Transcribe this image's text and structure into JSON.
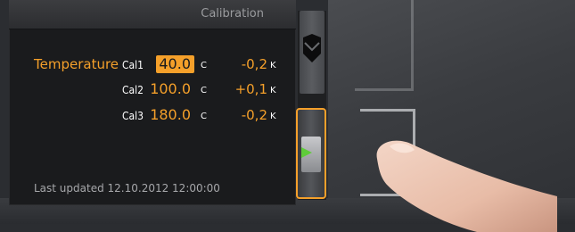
{
  "panel": {
    "title": "Calibration"
  },
  "temperature": {
    "label": "Temperature",
    "rows": [
      {
        "cal": "Cal1",
        "value": "40.0",
        "unit": "C",
        "offset": "-0,2",
        "offset_unit": "K",
        "selected": true
      },
      {
        "cal": "Cal2",
        "value": "100.0",
        "unit": "C",
        "offset": "+0,1",
        "offset_unit": "K",
        "selected": false
      },
      {
        "cal": "Cal3",
        "value": "180.0",
        "unit": "C",
        "offset": "-0,2",
        "offset_unit": "K",
        "selected": false
      }
    ]
  },
  "footer": {
    "last_updated": "Last updated  12.10.2012  12:00:00"
  },
  "colors": {
    "accent": "#f5a02a",
    "text": "#ffffff",
    "panel_bg": "#1a1b1d",
    "green": "#5fcc3a"
  },
  "icons": {
    "scroll_top": "chevron-down-icon",
    "scroll_thumb_marker": "arrow-right-icon"
  }
}
